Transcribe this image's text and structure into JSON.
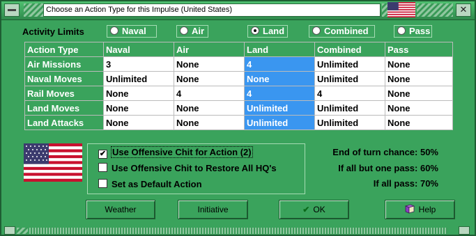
{
  "window": {
    "title": "Choose an Action Type for this Impulse (United States)",
    "close_label": "✕",
    "accent": "#3aa35c"
  },
  "activity": {
    "label": "Activity Limits",
    "options": [
      {
        "label": "Naval",
        "selected": false
      },
      {
        "label": "Air",
        "selected": false
      },
      {
        "label": "Land",
        "selected": true
      },
      {
        "label": "Combined",
        "selected": false
      },
      {
        "label": "Pass",
        "selected": false
      }
    ]
  },
  "table": {
    "headers": [
      "Action Type",
      "Naval",
      "Air",
      "Land",
      "Combined",
      "Pass"
    ],
    "rows": [
      {
        "label": "Air Missions",
        "cells": [
          "3",
          "None",
          "4",
          "Unlimited",
          "None"
        ]
      },
      {
        "label": "Naval Moves",
        "cells": [
          "Unlimited",
          "None",
          "None",
          "Unlimited",
          "None"
        ]
      },
      {
        "label": "Rail Moves",
        "cells": [
          "None",
          "4",
          "4",
          "4",
          "None"
        ]
      },
      {
        "label": "Land Moves",
        "cells": [
          "None",
          "None",
          "Unlimited",
          "Unlimited",
          "None"
        ]
      },
      {
        "label": "Land Attacks",
        "cells": [
          "None",
          "None",
          "Unlimited",
          "Unlimited",
          "None"
        ]
      }
    ],
    "selected_column": "Land",
    "selected_color": "#3a96f0"
  },
  "options": {
    "use_chit_action": {
      "label": "Use Offensive Chit for Action (2)",
      "checked": true,
      "mark": "✔"
    },
    "use_chit_restore": {
      "label": "Use Offensive Chit to Restore All HQ's",
      "checked": false,
      "mark": ""
    },
    "set_default": {
      "label": "Set as Default Action",
      "checked": false,
      "mark": ""
    }
  },
  "stats": {
    "end_of_turn": "End of turn chance: 50%",
    "all_but_one": "If all but one pass:  60%",
    "all_pass": "If all pass:  70%"
  },
  "buttons": {
    "weather": "Weather",
    "initiative": "Initiative",
    "ok": "OK",
    "ok_icon": "✔",
    "help": "Help",
    "help_icon": "book-icon"
  }
}
